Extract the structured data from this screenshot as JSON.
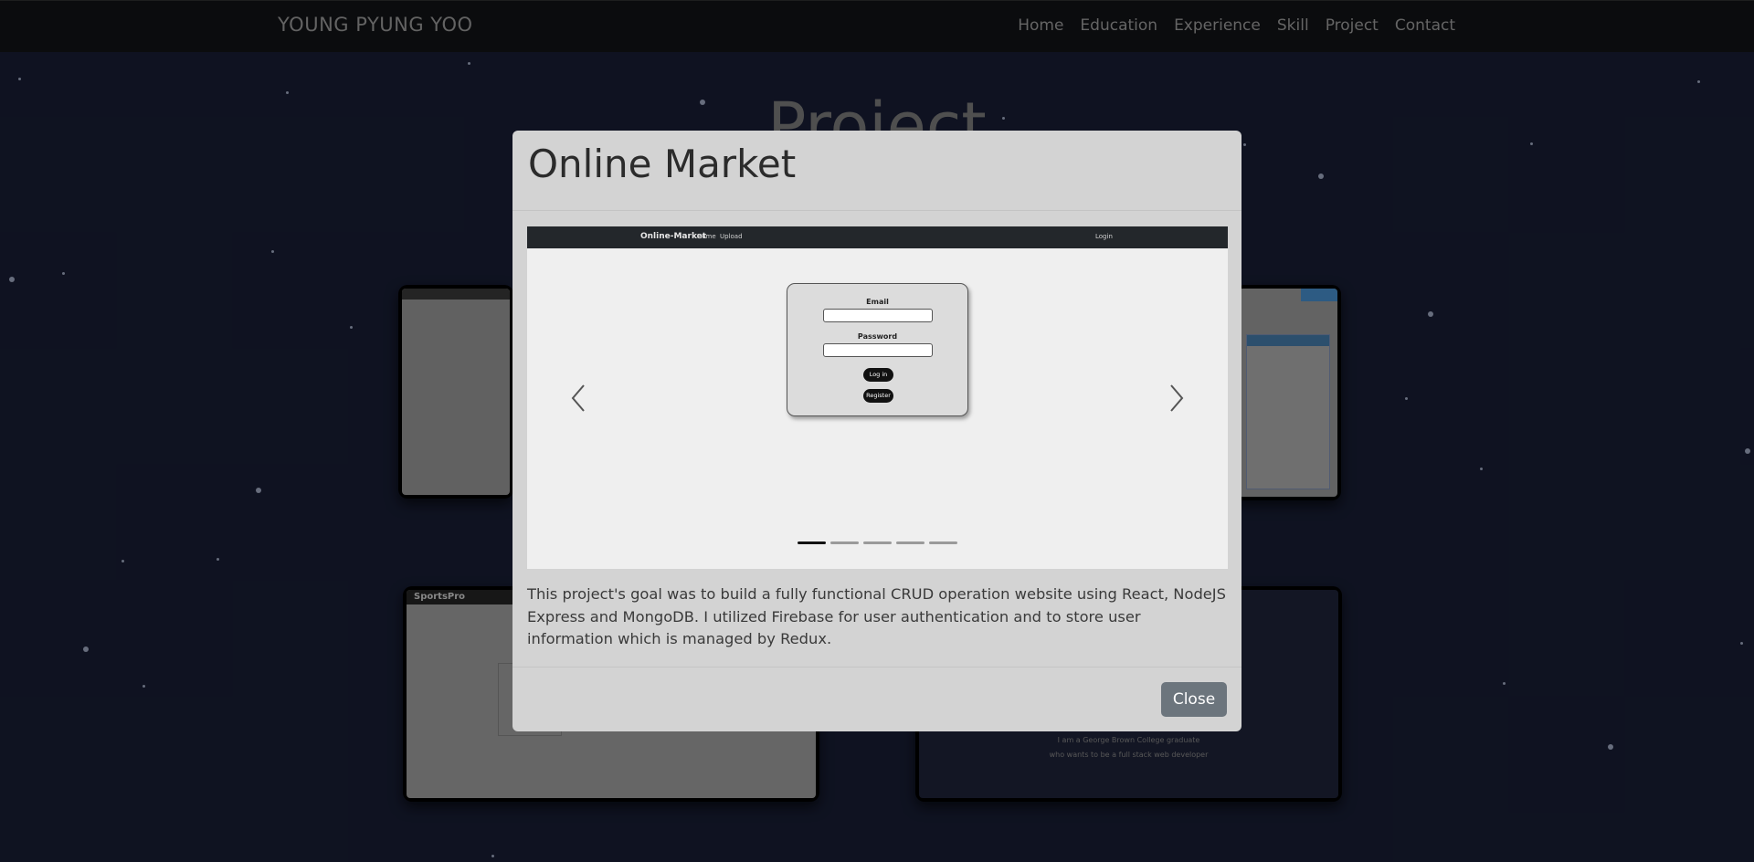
{
  "navbar": {
    "brand": "YOUNG PYUNG YOO",
    "links": [
      "Home",
      "Education",
      "Experience",
      "Skill",
      "Project",
      "Contact"
    ]
  },
  "background": {
    "section_title": "Project",
    "cards": {
      "sports_brand": "SportsPro",
      "about_line1": "I am a George Brown College graduate",
      "about_line2": "who wants to be a full stack web developer"
    }
  },
  "modal": {
    "title": "Online Market",
    "description": "This project's goal was to build a fully functional CRUD operation website using React, NodeJS Express and MongoDB. I utilized Firebase for user authentication and to store user information which is managed by Redux.",
    "close_label": "Close",
    "carousel": {
      "slide_count": 5,
      "active_index": 0,
      "slide": {
        "brand": "Online-Market",
        "nav_home": "Home",
        "nav_upload": "Upload",
        "nav_login": "Login",
        "email_label": "Email",
        "password_label": "Password",
        "login_button": "Log in",
        "register_button": "Register"
      }
    }
  },
  "colors": {
    "background": "#151a2e",
    "navbar": "#101114",
    "modal": "#d3d3d3",
    "close_button": "#6c757d"
  }
}
